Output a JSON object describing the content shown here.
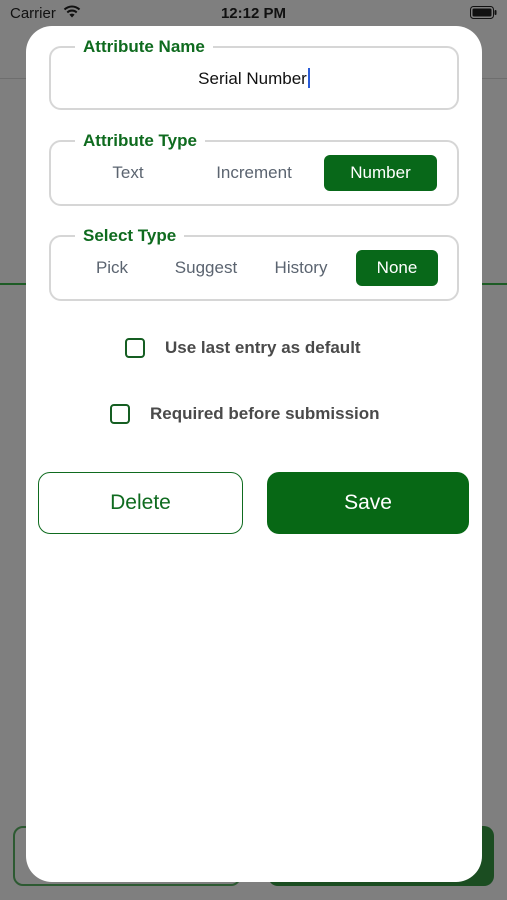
{
  "status_bar": {
    "carrier": "Carrier",
    "time": "12:12 PM"
  },
  "form": {
    "attribute_name": {
      "legend": "Attribute Name",
      "value": "Serial Number"
    },
    "attribute_type": {
      "legend": "Attribute Type",
      "options": [
        "Text",
        "Increment",
        "Number"
      ],
      "selected": "Number"
    },
    "select_type": {
      "legend": "Select Type",
      "options": [
        "Pick",
        "Suggest",
        "History",
        "None"
      ],
      "selected": "None"
    },
    "checkboxes": {
      "use_last_entry": {
        "label": "Use last entry as default",
        "checked": false
      },
      "required": {
        "label": "Required before submission",
        "checked": false
      }
    },
    "buttons": {
      "delete_label": "Delete",
      "save_label": "Save"
    }
  },
  "colors": {
    "accent": "#086819",
    "legend_text": "#0f6b1f",
    "overlay": "#7f7f7f"
  }
}
